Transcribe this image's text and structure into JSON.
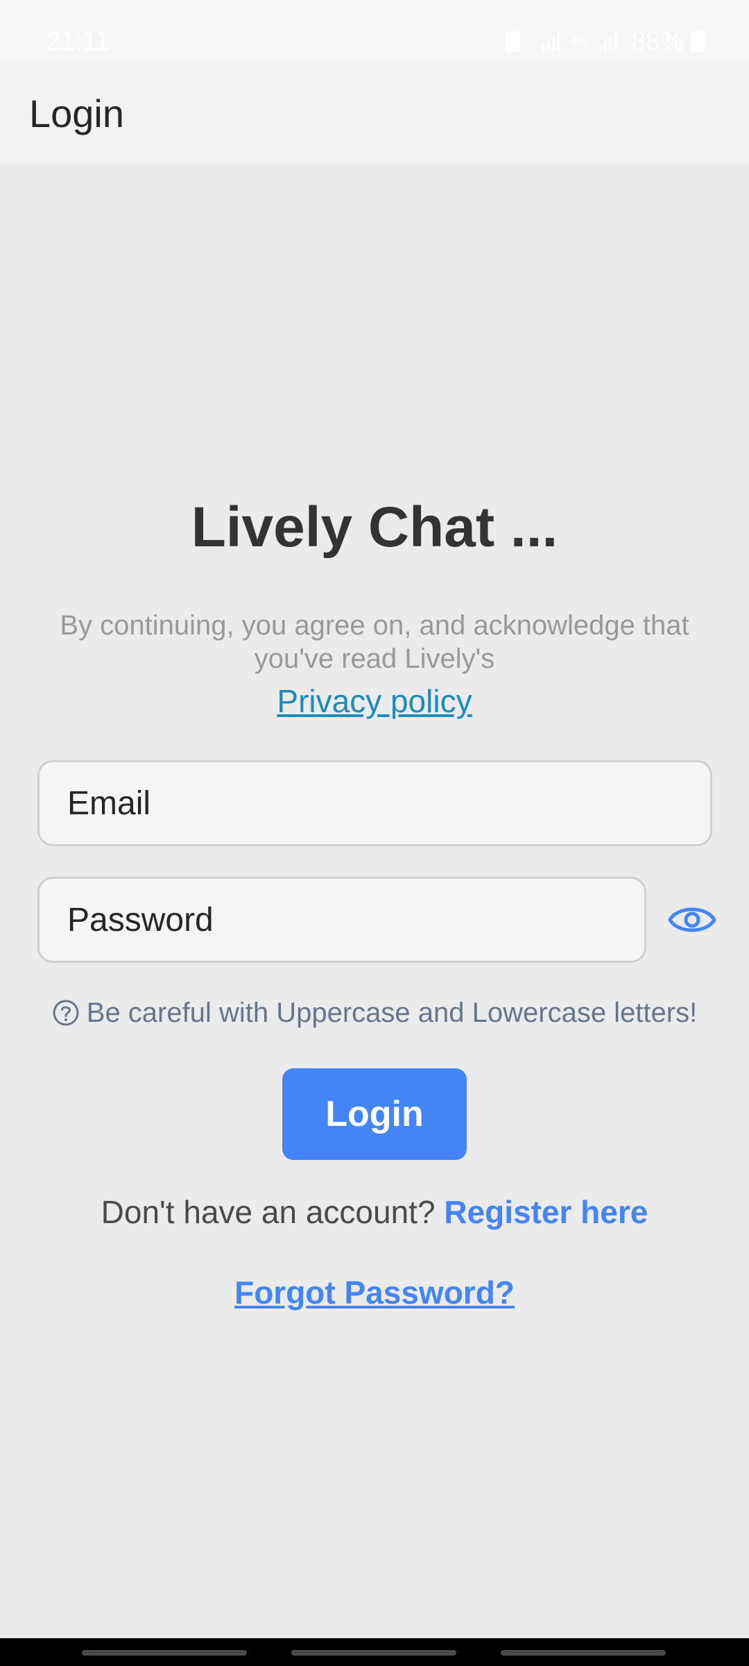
{
  "status_bar": {
    "time": "21:11",
    "data_type": "4G",
    "battery": "88%"
  },
  "app_bar": {
    "title": "Login"
  },
  "content": {
    "heading": "Lively Chat ...",
    "agreement_text": "By continuing, you agree on, and acknowledge that you've read Lively's",
    "privacy_link": "Privacy policy",
    "email_placeholder": "Email",
    "password_placeholder": "Password",
    "hint_text": "Be careful with Uppercase and Lowercase letters!",
    "login_button": "Login",
    "register_prompt": "Don't have an account? ",
    "register_link": "Register here",
    "forgot_link": "Forgot Password?"
  },
  "colors": {
    "accent": "#4385f4",
    "link": "#1a8bbd",
    "background": "#ebebeb"
  },
  "icons": {
    "password_toggle": "eye-icon",
    "hint": "help-circle-icon"
  }
}
